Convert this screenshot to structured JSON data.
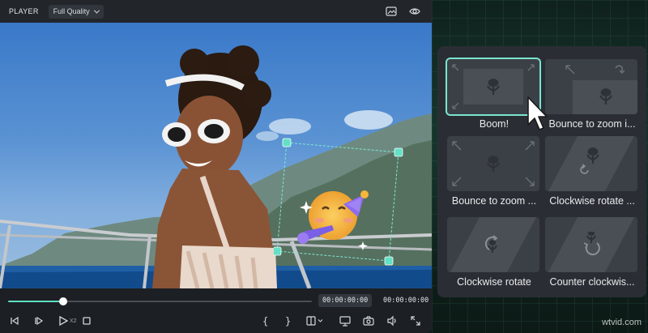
{
  "player": {
    "title": "PLAYER",
    "quality": "Full Quality",
    "current_time": "00:00:00:00",
    "total_time": "00:00:00:00",
    "progress": 0.18,
    "speed_label": "X2"
  },
  "effects": {
    "tiles": [
      {
        "label": "Boom!",
        "selected": true
      },
      {
        "label": "Bounce to zoom i..."
      },
      {
        "label": "Bounce to zoom ..."
      },
      {
        "label": "Clockwise rotate ..."
      },
      {
        "label": "Clockwise rotate"
      },
      {
        "label": "Counter clockwis..."
      }
    ]
  },
  "colors": {
    "accent": "#5fe0c4",
    "selection": "#79e4d0",
    "panel": "#2a2e34"
  },
  "watermark": "wtvid.com"
}
